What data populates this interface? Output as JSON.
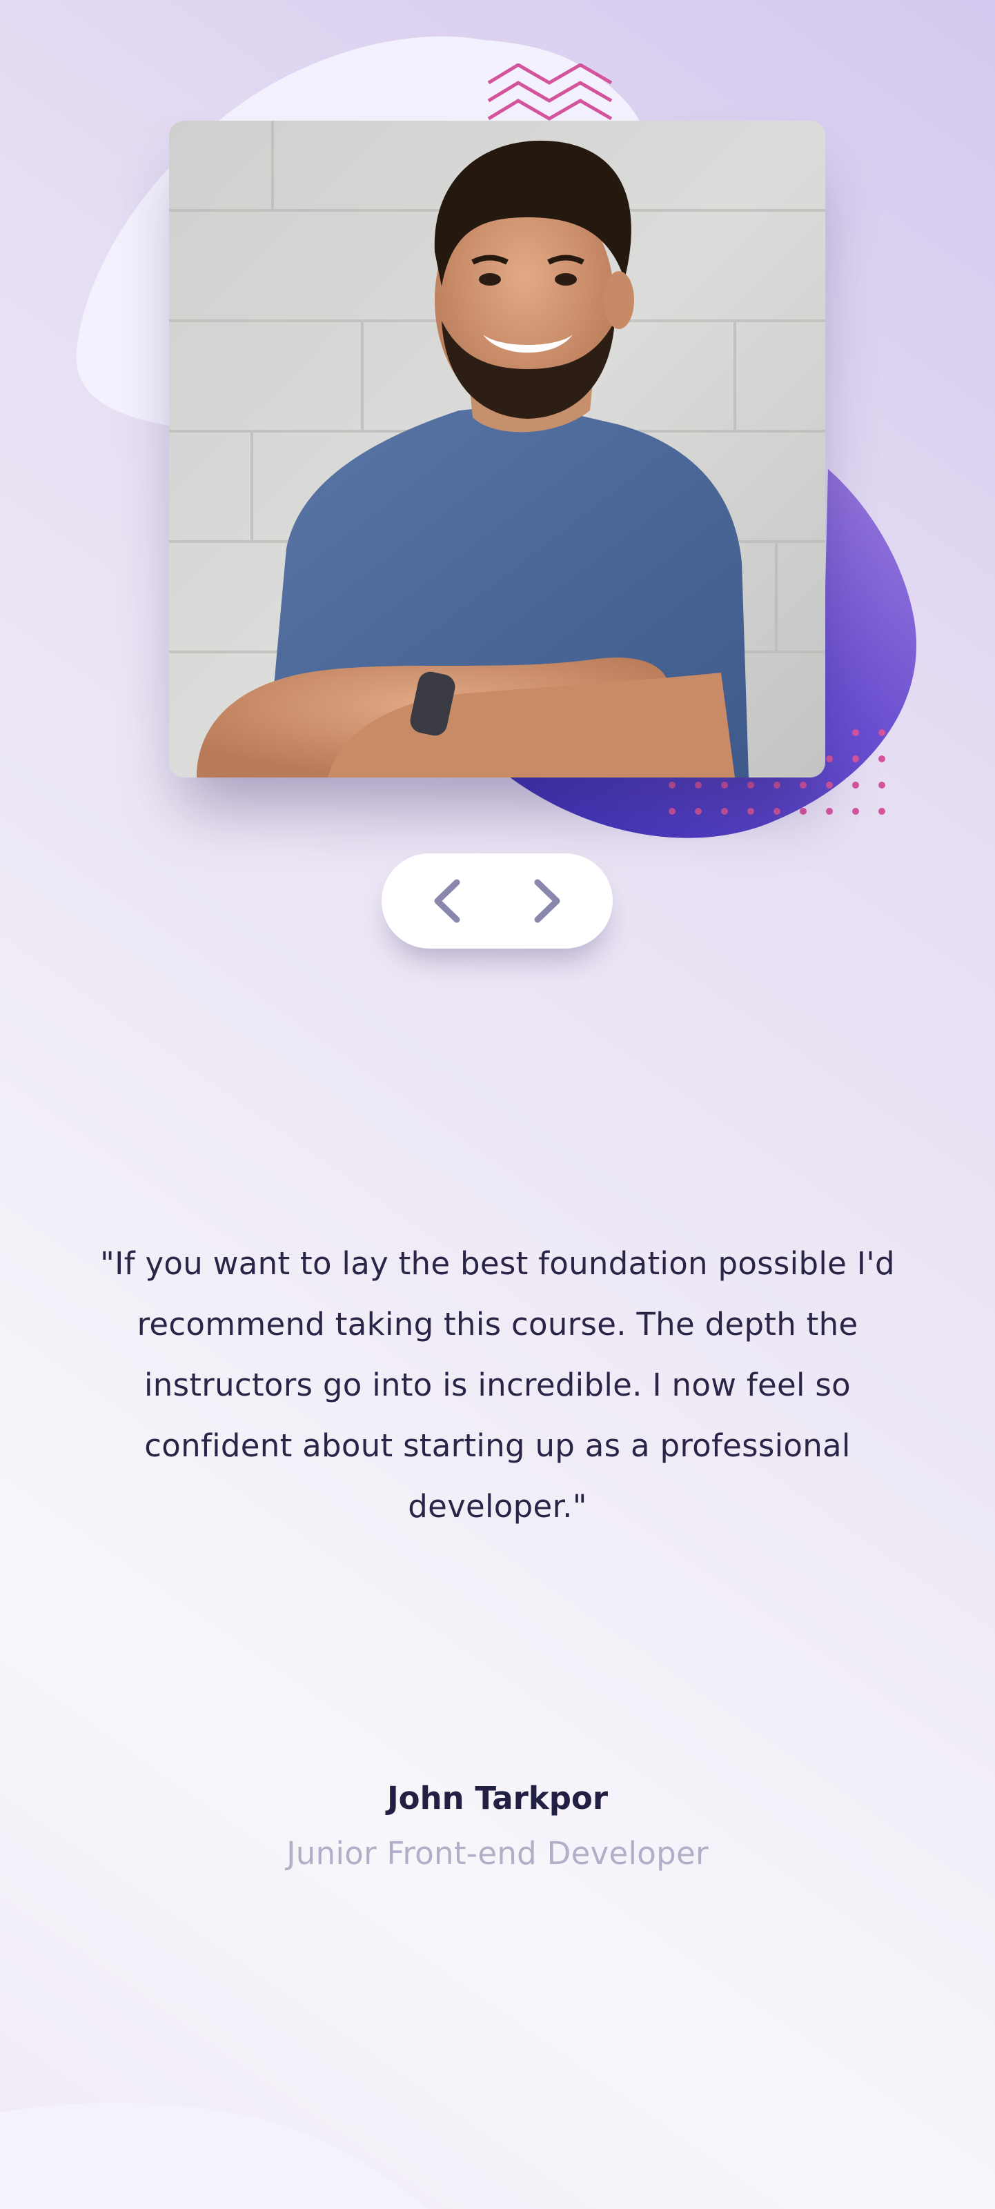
{
  "testimonial": {
    "quote": "\"If you want to lay the best foundation possible I'd recommend taking this course. The depth the instructors go into is incredible. I now feel so confident about starting up as a professional developer.\"",
    "name": "John Tarkpor",
    "role": "Junior Front-end Developer"
  },
  "navigation": {
    "prev_icon": "chevron-left-icon",
    "next_icon": "chevron-right-icon"
  },
  "photo": {
    "description_icon": "profile-photo"
  },
  "colors": {
    "accent_purple": "#4a3bb5",
    "accent_pink": "#d4549c",
    "text_dark": "#222042",
    "text_muted": "#b3aec8",
    "chevron": "#8a87ad"
  }
}
